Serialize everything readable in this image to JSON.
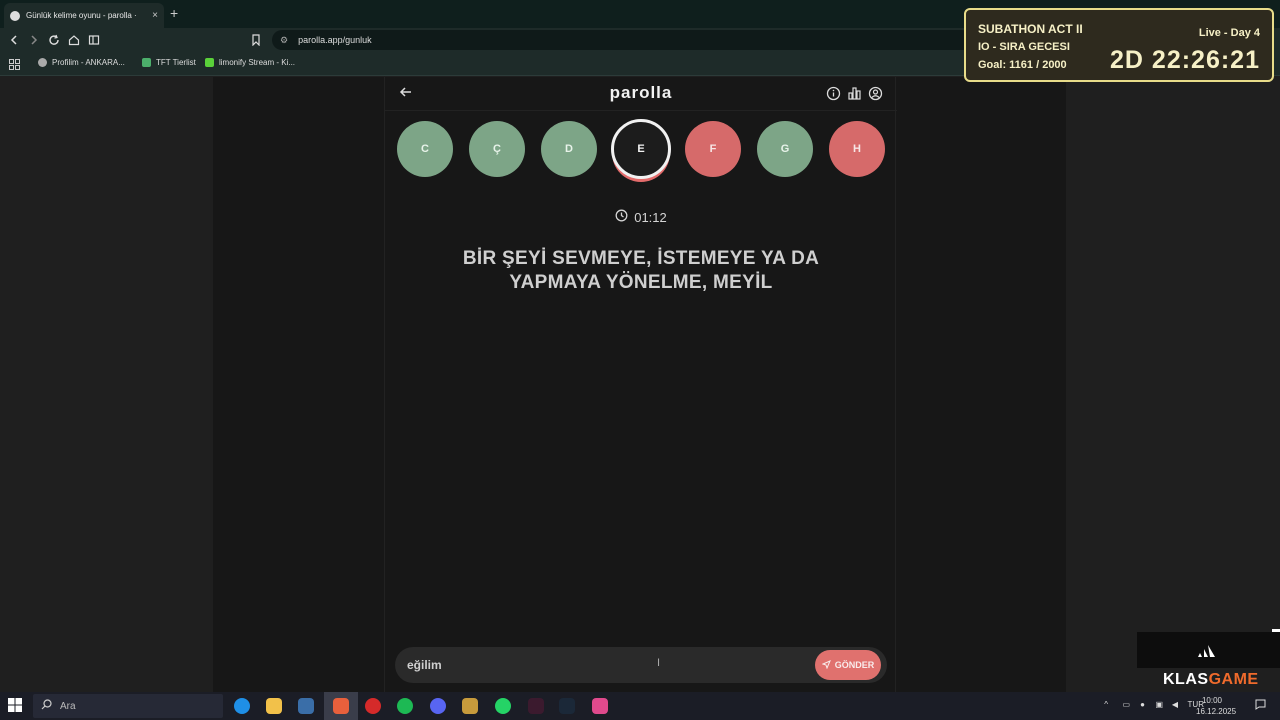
{
  "browser": {
    "tab_title": "Günlük kelime oyunu - parolla ·",
    "tab_close": "×",
    "new_tab": "+",
    "url": "parolla.app/gunluk",
    "bookmarks": [
      {
        "label": "Profilim - ANKARA..."
      },
      {
        "label": "TFT Tierlist"
      },
      {
        "label": "limonify Stream - Ki..."
      }
    ]
  },
  "app": {
    "logo": "parolla",
    "letters": [
      {
        "char": "C",
        "state": "correct"
      },
      {
        "char": "Ç",
        "state": "correct"
      },
      {
        "char": "D",
        "state": "correct"
      },
      {
        "char": "E",
        "state": "active"
      },
      {
        "char": "F",
        "state": "wrong"
      },
      {
        "char": "G",
        "state": "correct"
      },
      {
        "char": "H",
        "state": "wrong"
      }
    ],
    "timer": "01:12",
    "clue_line1": "BİR ŞEYİ SEVMEYE, İSTEMEYE YA DA",
    "clue_line2": "YAPMAYA YÖNELME, MEYİL",
    "answer_value": "eğilim",
    "send_label": "GÖNDER"
  },
  "overlay": {
    "title": "SUBATHON ACT II",
    "live": "Live - Day 4",
    "subtitle": "IO - SIRA GECESI",
    "goal": "Goal: 1161 / 2000",
    "countdown": "2D  22:26:21"
  },
  "brand": {
    "klas": "KLAS",
    "game": "GAME"
  },
  "taskbar": {
    "search_placeholder": "Ara",
    "lang": "TUR",
    "time": "10:00",
    "date": "16.12.2025"
  },
  "colors": {
    "correct": "#7da587",
    "wrong": "#d66a6a",
    "accent": "#e0716e"
  }
}
